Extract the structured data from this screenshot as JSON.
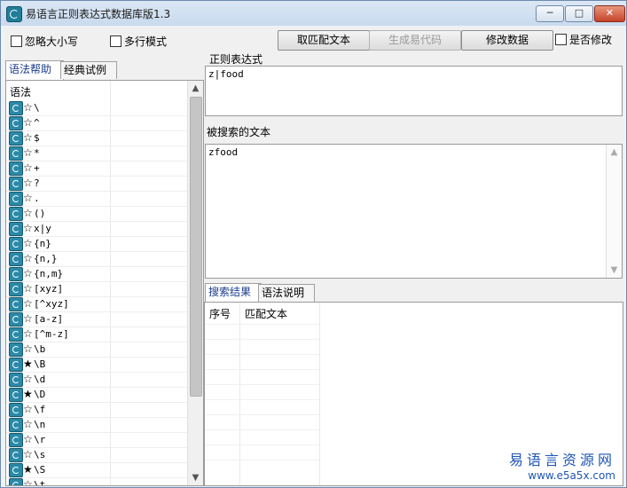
{
  "window": {
    "title": "易语言正则表达式数据库版1.3",
    "buttons": {
      "minimize": "─",
      "maximize": "□",
      "close": "✕"
    }
  },
  "options": {
    "ignore_case": {
      "label": "忽略大小写",
      "checked": false
    },
    "multiline": {
      "label": "多行模式",
      "checked": false
    },
    "modify": {
      "label": "是否修改",
      "checked": false
    }
  },
  "toolbar": {
    "take_match": "取匹配文本",
    "gen_code": "生成易代码",
    "modify_data": "修改数据"
  },
  "left_tabs": {
    "syntax_help": "语法帮助",
    "classic_examples": "经典试例"
  },
  "syntax_list": {
    "header": "语法",
    "rows": [
      {
        "star": "☆",
        "text": "\\"
      },
      {
        "star": "☆",
        "text": "^"
      },
      {
        "star": "☆",
        "text": "$"
      },
      {
        "star": "☆",
        "text": "*"
      },
      {
        "star": "☆",
        "text": "+"
      },
      {
        "star": "☆",
        "text": "?"
      },
      {
        "star": "☆",
        "text": "."
      },
      {
        "star": "☆",
        "text": "()"
      },
      {
        "star": "☆",
        "text": "x|y"
      },
      {
        "star": "☆",
        "text": "{n}"
      },
      {
        "star": "☆",
        "text": "{n,}"
      },
      {
        "star": "☆",
        "text": "{n,m}"
      },
      {
        "star": "☆",
        "text": "[xyz]"
      },
      {
        "star": "☆",
        "text": "[^xyz]"
      },
      {
        "star": "☆",
        "text": "[a-z]"
      },
      {
        "star": "☆",
        "text": "[^m-z]"
      },
      {
        "star": "☆",
        "text": "\\b"
      },
      {
        "star": "★",
        "text": "\\B"
      },
      {
        "star": "☆",
        "text": "\\d"
      },
      {
        "star": "★",
        "text": "\\D"
      },
      {
        "star": "☆",
        "text": "\\f"
      },
      {
        "star": "☆",
        "text": "\\n"
      },
      {
        "star": "☆",
        "text": "\\r"
      },
      {
        "star": "☆",
        "text": "\\s"
      },
      {
        "star": "★",
        "text": "\\S"
      },
      {
        "star": "☆",
        "text": "\\t"
      }
    ]
  },
  "regex": {
    "label": "正则表达式",
    "value": "z|food"
  },
  "search_text": {
    "label": "被搜索的文本",
    "value": "zfood"
  },
  "result_tabs": {
    "search_results": "搜索结果",
    "syntax_notes": "语法说明"
  },
  "results_table": {
    "columns": [
      "序号",
      "匹配文本"
    ],
    "rows": []
  },
  "watermark": {
    "line1": "易语言资源网",
    "line2": "www.e5a5x.com"
  },
  "icons": {
    "app": "app-logo-icon",
    "row": "syntax-item-icon",
    "scroll_up": "scroll-up-arrow-icon",
    "scroll_down": "scroll-down-arrow-icon"
  }
}
